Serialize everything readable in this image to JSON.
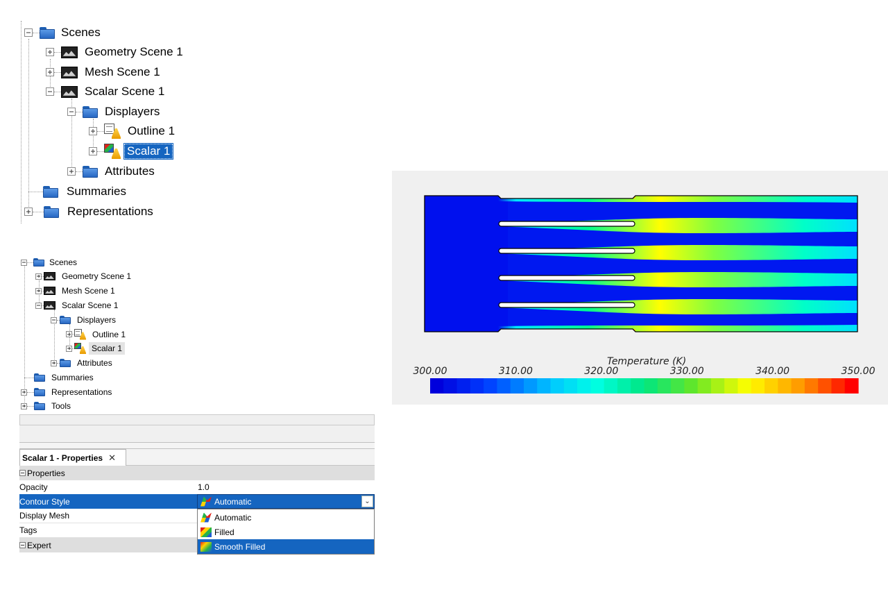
{
  "tree_large": {
    "items": [
      {
        "label": "Scenes",
        "icon": "folder-icon",
        "toggle": "minus"
      },
      {
        "label": "Geometry Scene 1",
        "icon": "scene-icon",
        "toggle": "plus"
      },
      {
        "label": "Mesh Scene 1",
        "icon": "scene-icon",
        "toggle": "plus"
      },
      {
        "label": "Scalar Scene 1",
        "icon": "scene-icon",
        "toggle": "minus"
      },
      {
        "label": "Displayers",
        "icon": "folder-icon",
        "toggle": "minus"
      },
      {
        "label": "Outline 1",
        "icon": "outline-displayer-icon",
        "toggle": "plus"
      },
      {
        "label": "Scalar 1",
        "icon": "scalar-displayer-icon",
        "toggle": "plus",
        "selected": true
      },
      {
        "label": "Attributes",
        "icon": "folder-icon",
        "toggle": "plus"
      },
      {
        "label": "Summaries",
        "icon": "folder-icon",
        "toggle": "none"
      },
      {
        "label": "Representations",
        "icon": "folder-icon",
        "toggle": "plus"
      }
    ]
  },
  "tree_small": {
    "items": [
      {
        "label": "Scenes",
        "icon": "folder-icon",
        "toggle": "minus"
      },
      {
        "label": "Geometry Scene 1",
        "icon": "scene-icon",
        "toggle": "plus"
      },
      {
        "label": "Mesh Scene 1",
        "icon": "scene-icon",
        "toggle": "plus"
      },
      {
        "label": "Scalar Scene 1",
        "icon": "scene-icon",
        "toggle": "minus"
      },
      {
        "label": "Displayers",
        "icon": "folder-icon",
        "toggle": "minus"
      },
      {
        "label": "Outline 1",
        "icon": "outline-displayer-icon",
        "toggle": "plus"
      },
      {
        "label": "Scalar 1",
        "icon": "scalar-displayer-icon",
        "toggle": "plus",
        "selected": true
      },
      {
        "label": "Attributes",
        "icon": "folder-icon",
        "toggle": "plus"
      },
      {
        "label": "Summaries",
        "icon": "folder-icon",
        "toggle": "none"
      },
      {
        "label": "Representations",
        "icon": "folder-icon",
        "toggle": "plus"
      },
      {
        "label": "Tools",
        "icon": "folder-icon",
        "toggle": "plus"
      }
    ]
  },
  "properties": {
    "tab_title": "Scalar 1 - Properties",
    "close_glyph": "✕",
    "group_properties": "Properties",
    "opacity_label": "Opacity",
    "opacity_value": "1.0",
    "contour_style_label": "Contour Style",
    "contour_style_value": "Automatic",
    "display_mesh_label": "Display Mesh",
    "tags_label": "Tags",
    "group_expert": "Expert",
    "dropdown_options": [
      "Automatic",
      "Filled",
      "Smooth Filled"
    ],
    "dropdown_highlighted": "Smooth Filled"
  },
  "colors": {
    "selection": "#1565c0",
    "folder": "#2767c2"
  },
  "chart_data": {
    "type": "heatmap",
    "title": "Temperature (K)",
    "colorbar": {
      "min": 300.0,
      "max": 350.0,
      "tick_labels": [
        "300.00",
        "310.00",
        "320.00",
        "330.00",
        "340.00",
        "350.00"
      ],
      "tick_values": [
        300,
        310,
        320,
        330,
        340,
        350
      ],
      "levels": 32,
      "colormap": "blue-cyan-green-yellow-red"
    }
  }
}
